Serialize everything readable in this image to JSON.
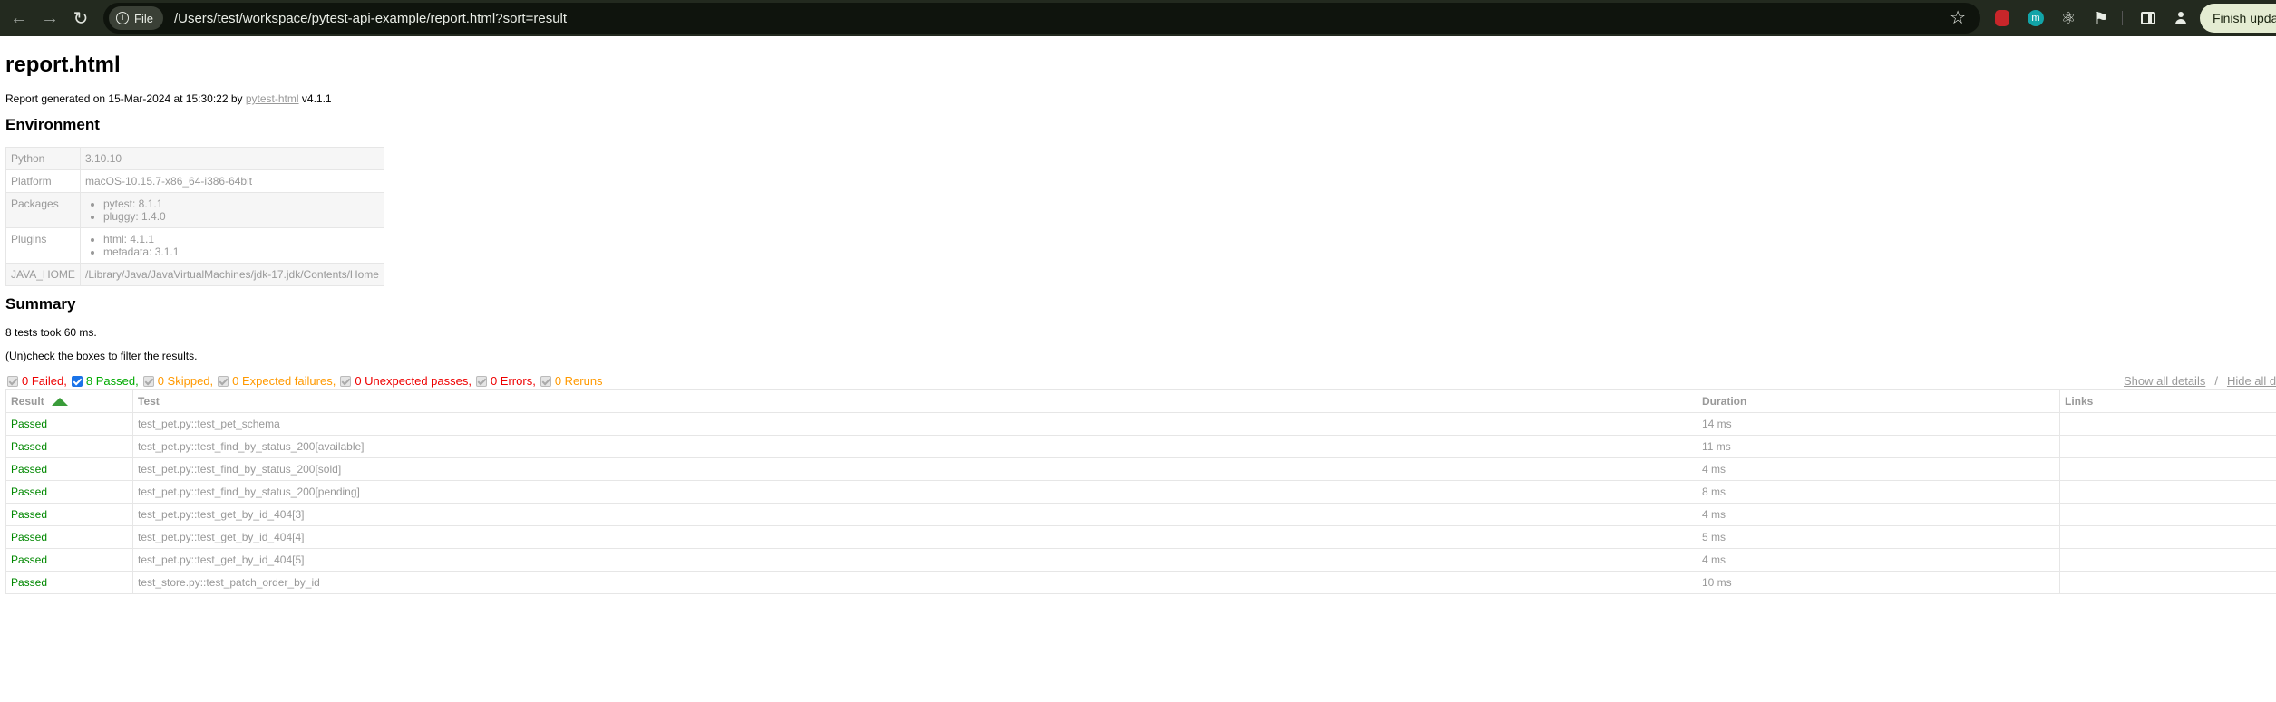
{
  "browser": {
    "url": "/Users/test/workspace/pytest-api-example/report.html?sort=result",
    "file_chip": "File",
    "finish_update": "Finish update"
  },
  "report": {
    "title": "report.html",
    "generated_prefix": "Report generated on 15-Mar-2024 at 15:30:22 by",
    "generated_link": "pytest-html",
    "generated_version": "v4.1.1"
  },
  "environment": {
    "heading": "Environment",
    "python_key": "Python",
    "python_val": "3.10.10",
    "platform_key": "Platform",
    "platform_val": "macOS-10.15.7-x86_64-i386-64bit",
    "packages_key": "Packages",
    "packages": [
      "pytest: 8.1.1",
      "pluggy: 1.4.0"
    ],
    "plugins_key": "Plugins",
    "plugins": [
      "html: 4.1.1",
      "metadata: 3.1.1"
    ],
    "java_key": "JAVA_HOME",
    "java_val": "/Library/Java/JavaVirtualMachines/jdk-17.jdk/Contents/Home"
  },
  "summary": {
    "heading": "Summary",
    "took": "8 tests took 60 ms.",
    "uncheck": "(Un)check the boxes to filter the results.",
    "filters": [
      {
        "label": "0 Failed,",
        "checked": false
      },
      {
        "label": "8 Passed,",
        "checked": true
      },
      {
        "label": "0 Skipped,",
        "checked": false
      },
      {
        "label": "0 Expected failures,",
        "checked": false
      },
      {
        "label": "0 Unexpected passes,",
        "checked": false
      },
      {
        "label": "0 Errors,",
        "checked": false
      },
      {
        "label": "0 Reruns",
        "checked": false
      }
    ],
    "show_all": "Show all details",
    "slash": "/",
    "hide_all": "Hide all details"
  },
  "results": {
    "headers": [
      "Result",
      "Test",
      "Duration",
      "Links"
    ],
    "rows": [
      {
        "result": "Passed",
        "test": "test_pet.py::test_pet_schema",
        "duration": "14 ms"
      },
      {
        "result": "Passed",
        "test": "test_pet.py::test_find_by_status_200[available]",
        "duration": "11 ms"
      },
      {
        "result": "Passed",
        "test": "test_pet.py::test_find_by_status_200[sold]",
        "duration": "4 ms"
      },
      {
        "result": "Passed",
        "test": "test_pet.py::test_find_by_status_200[pending]",
        "duration": "8 ms"
      },
      {
        "result": "Passed",
        "test": "test_pet.py::test_get_by_id_404[3]",
        "duration": "4 ms"
      },
      {
        "result": "Passed",
        "test": "test_pet.py::test_get_by_id_404[4]",
        "duration": "5 ms"
      },
      {
        "result": "Passed",
        "test": "test_pet.py::test_get_by_id_404[5]",
        "duration": "4 ms"
      },
      {
        "result": "Passed",
        "test": "test_store.py::test_patch_order_by_id",
        "duration": "10 ms"
      }
    ]
  }
}
